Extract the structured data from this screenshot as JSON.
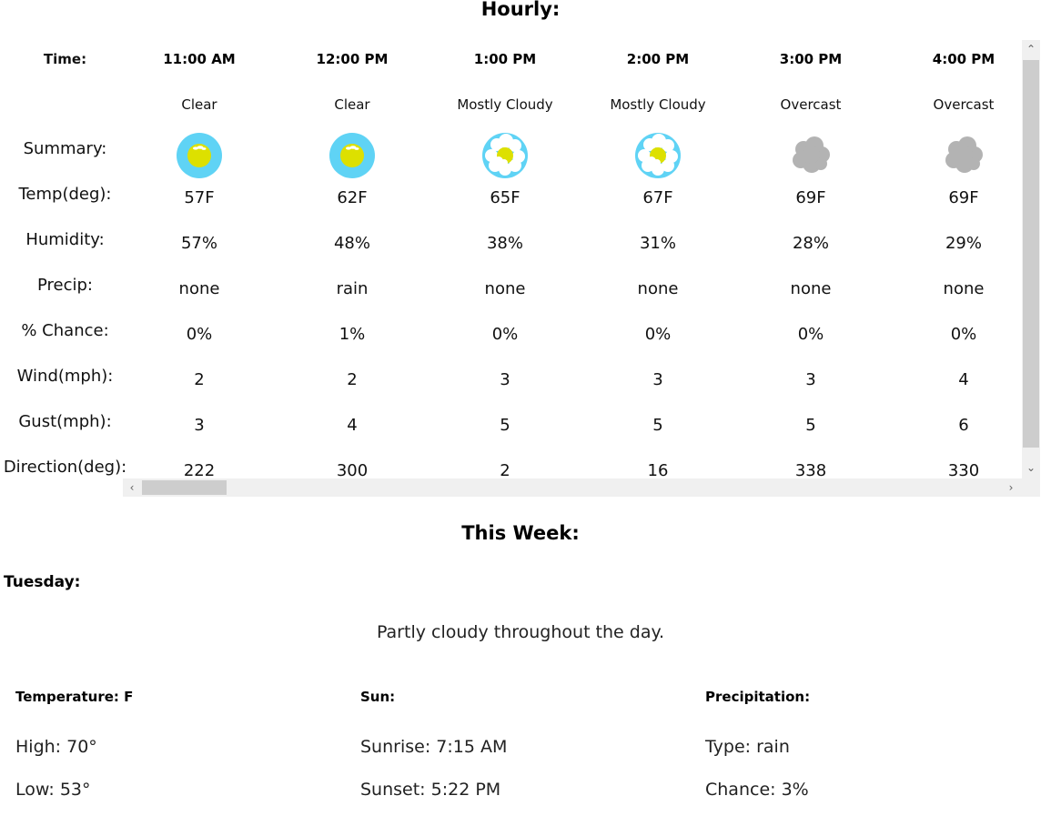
{
  "hourly": {
    "title": "Hourly:",
    "labels": {
      "time": "Time:",
      "summary": "Summary:",
      "temp": "Temp(deg):",
      "humidity": "Humidity:",
      "precip": "Precip:",
      "chance": "% Chance:",
      "wind": "Wind(mph):",
      "gust": "Gust(mph):",
      "direction": "Direction(deg):"
    },
    "hours": [
      {
        "time": "11:00 AM",
        "summary": "Clear",
        "icon": "clear-day-icon",
        "temp": "57F",
        "humidity": "57%",
        "precip": "none",
        "chance": "0%",
        "wind": "2",
        "gust": "3",
        "direction": "222"
      },
      {
        "time": "12:00 PM",
        "summary": "Clear",
        "icon": "clear-day-icon",
        "temp": "62F",
        "humidity": "48%",
        "precip": "rain",
        "chance": "1%",
        "wind": "2",
        "gust": "4",
        "direction": "300"
      },
      {
        "time": "1:00 PM",
        "summary": "Mostly Cloudy",
        "icon": "partly-cloudy-day-icon",
        "temp": "65F",
        "humidity": "38%",
        "precip": "none",
        "chance": "0%",
        "wind": "3",
        "gust": "5",
        "direction": "2"
      },
      {
        "time": "2:00 PM",
        "summary": "Mostly Cloudy",
        "icon": "partly-cloudy-day-icon",
        "temp": "67F",
        "humidity": "31%",
        "precip": "none",
        "chance": "0%",
        "wind": "3",
        "gust": "5",
        "direction": "16"
      },
      {
        "time": "3:00 PM",
        "summary": "Overcast",
        "icon": "cloudy-icon",
        "temp": "69F",
        "humidity": "28%",
        "precip": "none",
        "chance": "0%",
        "wind": "3",
        "gust": "5",
        "direction": "338"
      },
      {
        "time": "4:00 PM",
        "summary": "Overcast",
        "icon": "cloudy-icon",
        "temp": "69F",
        "humidity": "29%",
        "precip": "none",
        "chance": "0%",
        "wind": "4",
        "gust": "6",
        "direction": "330"
      }
    ]
  },
  "week": {
    "title": "This Week:",
    "day": {
      "name": "Tuesday:",
      "summary": "Partly cloudy throughout the day.",
      "temperature": {
        "heading": "Temperature: F",
        "high": "High: 70°",
        "low": "Low: 53°"
      },
      "sun": {
        "heading": "Sun:",
        "sunrise": "Sunrise: 7:15 AM",
        "sunset": "Sunset: 5:22 PM"
      },
      "precipitation": {
        "heading": "Precipitation:",
        "type": "Type: rain",
        "chance": "Chance: 3%"
      }
    }
  },
  "colors": {
    "sky": "#5fd3f5",
    "sun": "#dde000",
    "cloud_white": "#ffffff",
    "cloud_gray": "#b3b3b3",
    "scrollbar_track": "#f0f0f0",
    "scrollbar_thumb": "#cdcdcd"
  }
}
